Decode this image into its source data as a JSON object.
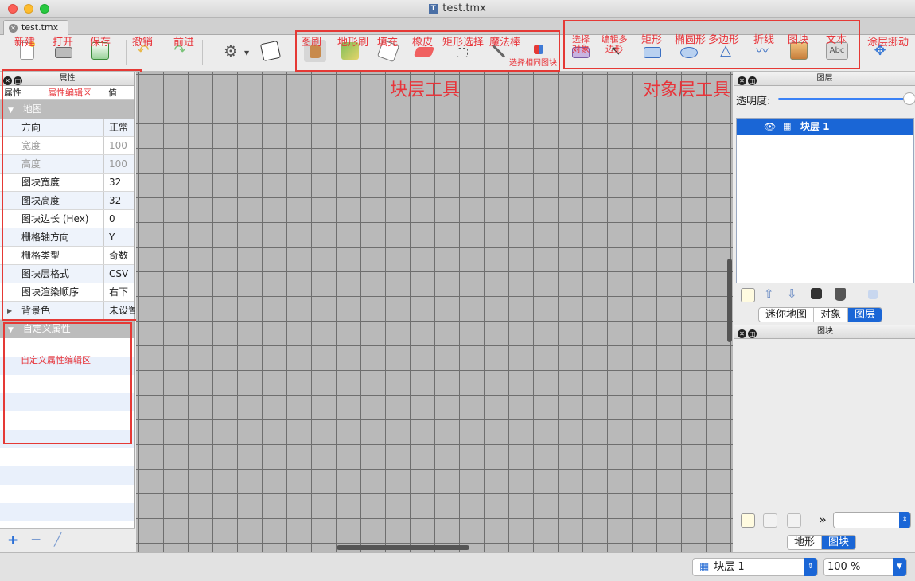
{
  "window": {
    "title": "test.tmx"
  },
  "tabs": [
    {
      "label": "test.tmx"
    }
  ],
  "toolbar": {
    "new": "新建",
    "open": "打开",
    "save": "保存",
    "undo": "撤销",
    "redo": "前进",
    "stamp": "图刷",
    "terrain": "地形刷",
    "fill": "填充",
    "eraser": "橡皮",
    "rect_select": "矩形选择",
    "magic_wand": "魔法棒",
    "select_same": "选择相同图块",
    "select_objects": "选择对象",
    "edit_polygon": "编辑多边形",
    "rectangle": "矩形",
    "ellipse": "椭圆形",
    "polygon": "多边形",
    "polyline": "折线",
    "tile": "图块",
    "text": "文本",
    "layer_offset": "涂层挪动",
    "tile_layer_tools": "块层工具",
    "object_layer_tools": "对象层工具",
    "icons": [
      "new-icon",
      "open-icon",
      "save-icon",
      "undo-icon",
      "redo-icon",
      "gears-icon",
      "dice-icon",
      "stamp-icon",
      "terrain-icon",
      "fill-icon",
      "eraser-icon",
      "rect-select-icon",
      "magic-wand-icon",
      "select-same-icon",
      "select-objects-icon",
      "edit-polygon-icon",
      "rectangle-icon",
      "ellipse-icon",
      "polygon-icon",
      "polyline-icon",
      "tile-icon",
      "text-icon",
      "move-icon"
    ]
  },
  "properties": {
    "title": "属性",
    "col_property": "属性",
    "edit_area": "属性编辑区",
    "col_value": "值",
    "group_map": "地图",
    "rows": [
      {
        "key": "方向",
        "value": "正常"
      },
      {
        "key": "宽度",
        "value": "100"
      },
      {
        "key": "高度",
        "value": "100"
      },
      {
        "key": "图块宽度",
        "value": "32"
      },
      {
        "key": "图块高度",
        "value": "32"
      },
      {
        "key": "图块边长 (Hex)",
        "value": "0"
      },
      {
        "key": "栅格轴方向",
        "value": "Y"
      },
      {
        "key": "栅格类型",
        "value": "奇数"
      },
      {
        "key": "图块层格式",
        "value": "CSV"
      },
      {
        "key": "图块渲染顺序",
        "value": "右下"
      },
      {
        "key": "背景色",
        "value": "未设置"
      }
    ],
    "custom_group": "自定义属性",
    "custom_area": "自定义属性编辑区"
  },
  "layers": {
    "title": "图层",
    "opacity_label": "透明度:",
    "layer_name": "块层 1",
    "tabs": [
      "迷你地图",
      "对象",
      "图层"
    ],
    "active_tab": "图层"
  },
  "tilesets": {
    "title": "图块",
    "tabs": [
      "地形",
      "图块"
    ],
    "active_tab": "图块",
    "more": "»"
  },
  "status": {
    "layer": "块层 1",
    "zoom": "100 %"
  },
  "colors": {
    "annotation": "#e53935",
    "selection": "#1a66d6"
  }
}
